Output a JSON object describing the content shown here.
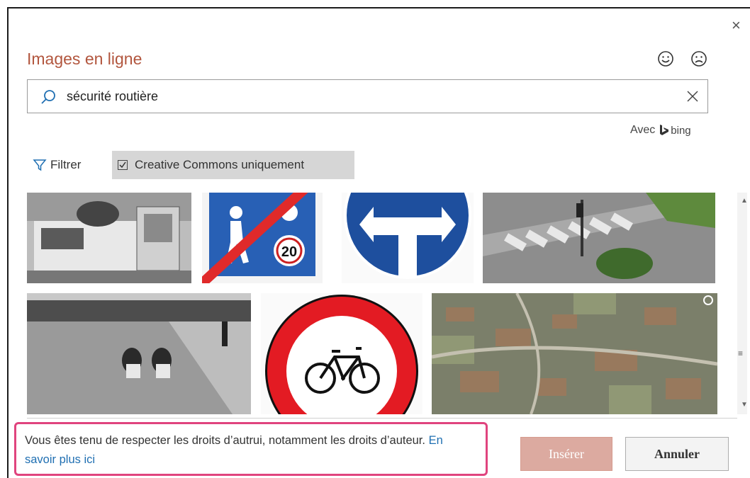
{
  "dialog": {
    "title": "Images en ligne",
    "close_icon": "close-icon",
    "feedback": {
      "happy_icon": "smiley-happy-icon",
      "sad_icon": "smiley-sad-icon"
    }
  },
  "search": {
    "value": "sécurité routière",
    "icon": "search-icon",
    "clear_icon": "clear-icon"
  },
  "provider": {
    "prefix": "Avec",
    "name": "bing"
  },
  "filters": {
    "filter_label": "Filtrer",
    "creative_commons_label": "Creative Commons uniquement",
    "creative_commons_checked": true
  },
  "results": [
    {
      "name": "Vintage car photo"
    },
    {
      "name": "End of pedestrian zone sign, 20"
    },
    {
      "name": "Mandatory direction sign"
    },
    {
      "name": "Aerial crosswalk intersection"
    },
    {
      "name": "Workers marking road"
    },
    {
      "name": "No bicycles sign"
    },
    {
      "name": "Aerial city view"
    }
  ],
  "notice": {
    "text": "Vous êtes tenu de respecter les droits d’autrui, notamment les droits d’auteur. ",
    "link": "En savoir plus ici"
  },
  "buttons": {
    "insert": "Insérer",
    "cancel": "Annuler"
  },
  "colors": {
    "title": "#b2563e",
    "link": "#1f6fb2",
    "highlight_border": "#e0447e",
    "insert_disabled": "#dcaaa0"
  }
}
